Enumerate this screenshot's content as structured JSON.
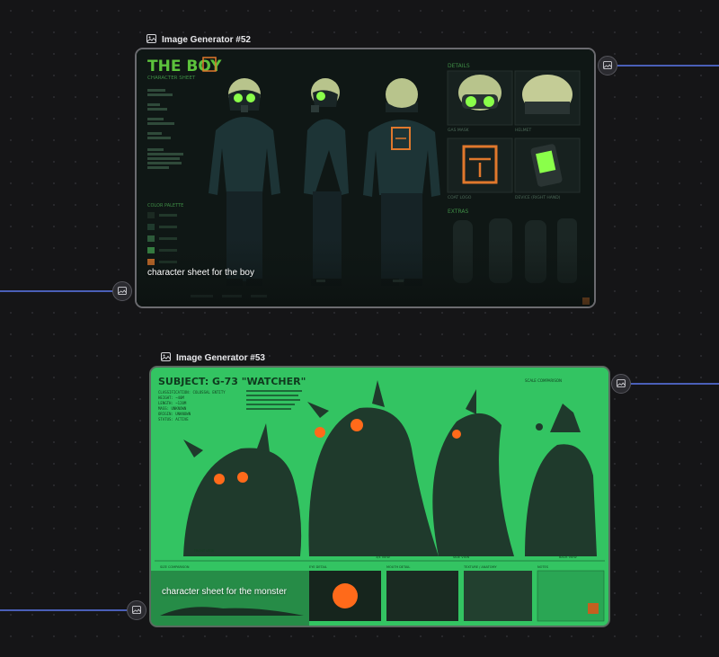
{
  "nodes": [
    {
      "title": "Image Generator #52",
      "caption": "character sheet for the boy",
      "sheet": {
        "title": "THE BOY",
        "subtitle": "CHARACTER SHEET",
        "details_label": "DETAILS",
        "extras_label": "EXTRAS",
        "color_palette_label": "COLOR PALETTE",
        "detail_labels": [
          "GAS MASK",
          "HELMET",
          "COAT LOGO",
          "DEVICE (RIGHT HAND)"
        ]
      }
    },
    {
      "title": "Image Generator #53",
      "caption": "character sheet for the monster",
      "sheet": {
        "title": "SUBJECT: G-73 \"WATCHER\"",
        "scale_label": "SCALE COMPARISON",
        "info_lines": [
          "CLASSIFICATION: COLOSSAL ENTITY",
          "HEIGHT: ~40M",
          "LENGTH: ~120M",
          "MASS: UNKNOWN",
          "ORIGIN: UNKNOWN",
          "STATUS: ACTIVE"
        ],
        "view_labels": [
          "FRONT VIEW",
          "3/4 VIEW",
          "SIDE VIEW",
          "BACK VIEW"
        ],
        "bottom_labels": [
          "SIZE COMPARISON",
          "EYE DETAIL",
          "MOUTH DETAIL",
          "TEXTURE / ANATOMY",
          "NOTES"
        ]
      }
    }
  ],
  "colors": {
    "edge": "#4a5fb8",
    "boy_accent": "#4caf3a",
    "boy_orange": "#e0782c",
    "monster_green": "#35c865",
    "monster_eye": "#ff6a1a"
  },
  "icons": [
    "image-icon"
  ]
}
